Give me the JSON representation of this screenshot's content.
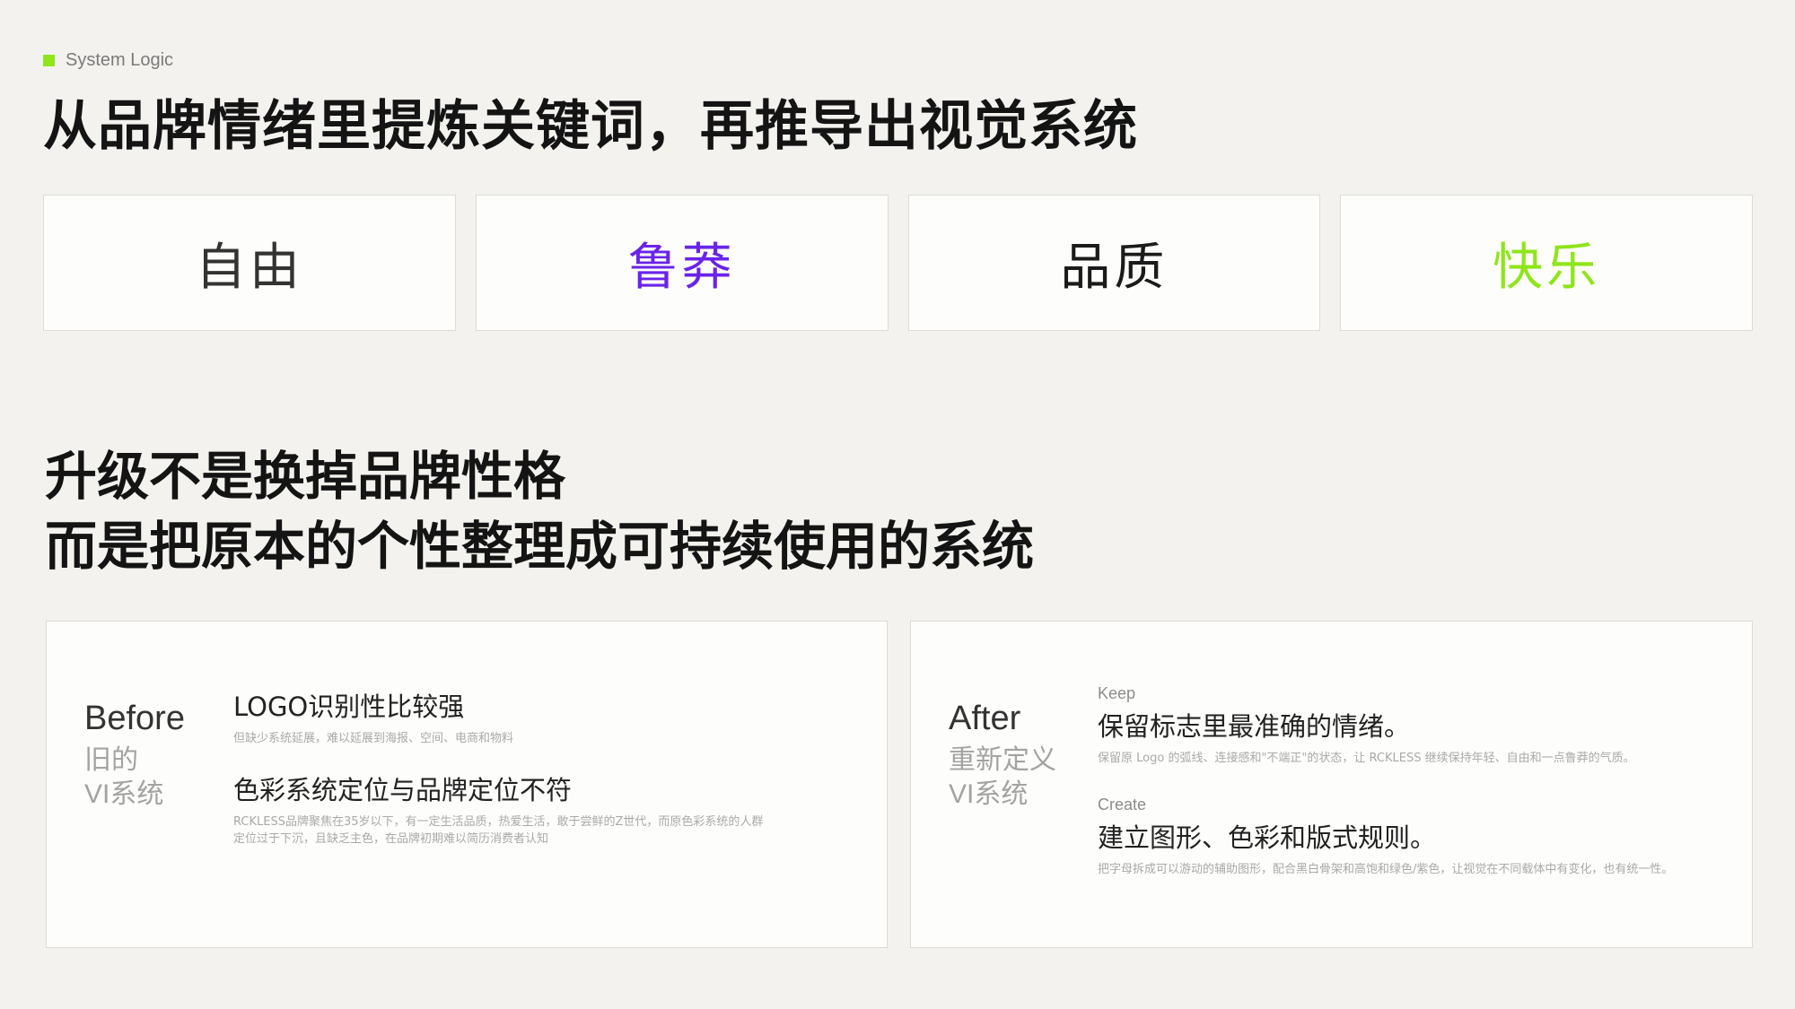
{
  "header": {
    "tag": "System Logic",
    "accent": "#8fe51a",
    "headline": "从品牌情绪里提炼关键词，再推导出视觉系统"
  },
  "keywords": [
    {
      "label": "自由",
      "color": "#333333"
    },
    {
      "label": "鲁莽",
      "color": "#6a24e8"
    },
    {
      "label": "品质",
      "color": "#1b1b1b"
    },
    {
      "label": "快乐",
      "color": "#8fe51a"
    }
  ],
  "subhead": {
    "line1": "升级不是换掉品牌性格",
    "line2": "而是把原本的个性整理成可持续使用的系统"
  },
  "before": {
    "en": "Before",
    "zh1": "旧的",
    "zh2": "VI系统",
    "items": [
      {
        "title": "LOGO识别性比较强",
        "desc": "但缺少系统延展，难以延展到海报、空间、电商和物料"
      },
      {
        "title": "色彩系统定位与品牌定位不符",
        "desc": "RCKLESS品牌聚焦在35岁以下，有一定生活品质，热爱生活，敢于尝鲜的Z世代，而原色彩系统的人群定位过于下沉，且缺乏主色，在品牌初期难以简历消费者认知"
      }
    ]
  },
  "after": {
    "en": "After",
    "zh1": "重新定义",
    "zh2": "VI系统",
    "items": [
      {
        "label": "Keep",
        "title": "保留标志里最准确的情绪。",
        "desc": "保留原 Logo 的弧线、连接感和\"不端正\"的状态，让 RCKLESS 继续保持年轻、自由和一点鲁莽的气质。"
      },
      {
        "label": "Create",
        "title": "建立图形、色彩和版式规则。",
        "desc": "把字母拆成可以游动的辅助图形，配合黑白骨架和高饱和绿色/紫色，让视觉在不同载体中有变化，也有统一性。"
      }
    ]
  }
}
